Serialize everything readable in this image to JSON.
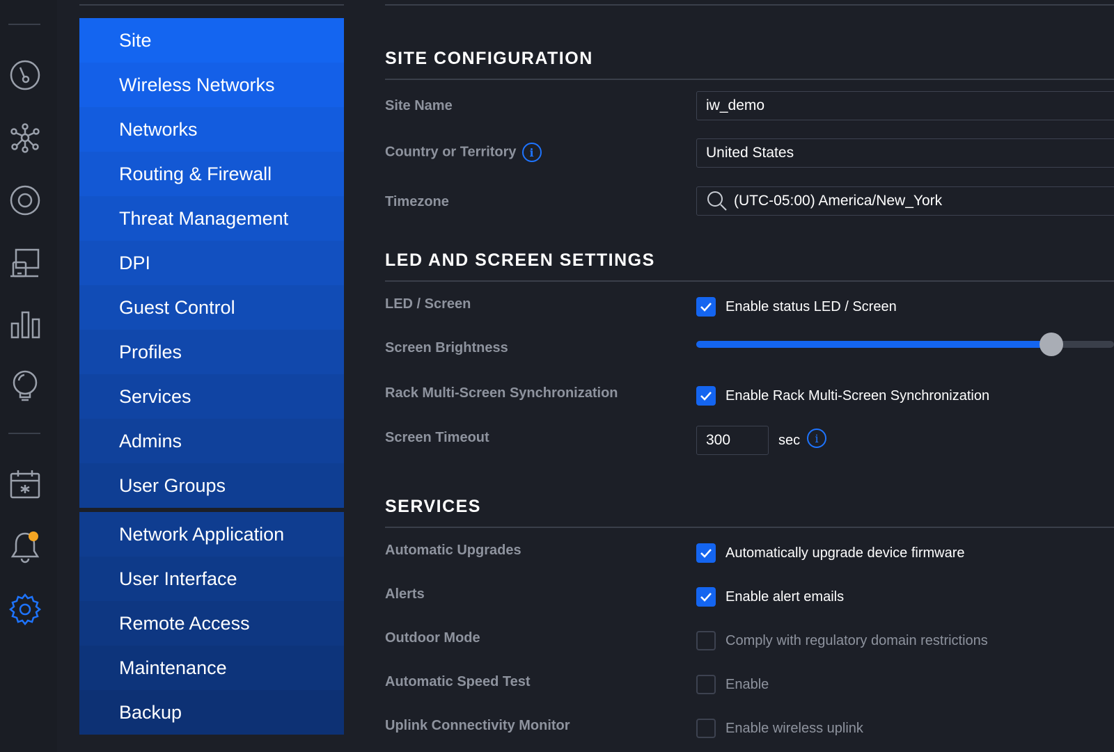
{
  "rail": {
    "icons": [
      "dashboard-icon",
      "topology-icon",
      "devices-icon",
      "clients-icon",
      "statistics-icon",
      "insights-icon",
      "events-icon",
      "alerts-icon",
      "settings-icon"
    ]
  },
  "menu": {
    "items": [
      {
        "label": "Site",
        "active": true
      },
      {
        "label": "Wireless Networks"
      },
      {
        "label": "Networks"
      },
      {
        "label": "Routing & Firewall"
      },
      {
        "label": "Threat Management"
      },
      {
        "label": "DPI"
      },
      {
        "label": "Guest Control"
      },
      {
        "label": "Profiles"
      },
      {
        "label": "Services"
      },
      {
        "label": "Admins"
      },
      {
        "label": "User Groups"
      },
      {
        "label": "Network Application"
      },
      {
        "label": "User Interface"
      },
      {
        "label": "Remote Access"
      },
      {
        "label": "Maintenance"
      },
      {
        "label": "Backup"
      }
    ]
  },
  "site_config": {
    "title": "SITE CONFIGURATION",
    "site_name_label": "Site Name",
    "site_name_value": "iw_demo",
    "country_label": "Country or Territory",
    "country_value": "United States",
    "timezone_label": "Timezone",
    "timezone_value": "(UTC-05:00) America/New_York"
  },
  "led": {
    "title": "LED AND SCREEN SETTINGS",
    "led_label": "LED / Screen",
    "led_checkbox": "Enable status LED / Screen",
    "brightness_label": "Screen Brightness",
    "brightness_level": 0.85,
    "rack_label": "Rack Multi-Screen Synchronization",
    "rack_checkbox": "Enable Rack Multi-Screen Synchronization",
    "timeout_label": "Screen Timeout",
    "timeout_value": "300",
    "timeout_unit": "sec"
  },
  "services": {
    "title": "SERVICES",
    "auto_upgrade_label": "Automatic Upgrades",
    "auto_upgrade_checkbox": "Automatically upgrade device firmware",
    "alerts_label": "Alerts",
    "alerts_checkbox": "Enable alert emails",
    "outdoor_label": "Outdoor Mode",
    "outdoor_checkbox": "Comply with regulatory domain restrictions",
    "speedtest_label": "Automatic Speed Test",
    "speedtest_checkbox": "Enable",
    "uplink_label": "Uplink Connectivity Monitor",
    "uplink_checkbox": "Enable wireless uplink"
  },
  "colors": {
    "accent": "#1465f0",
    "background": "#1c1f27",
    "badge": "#f5a623"
  }
}
